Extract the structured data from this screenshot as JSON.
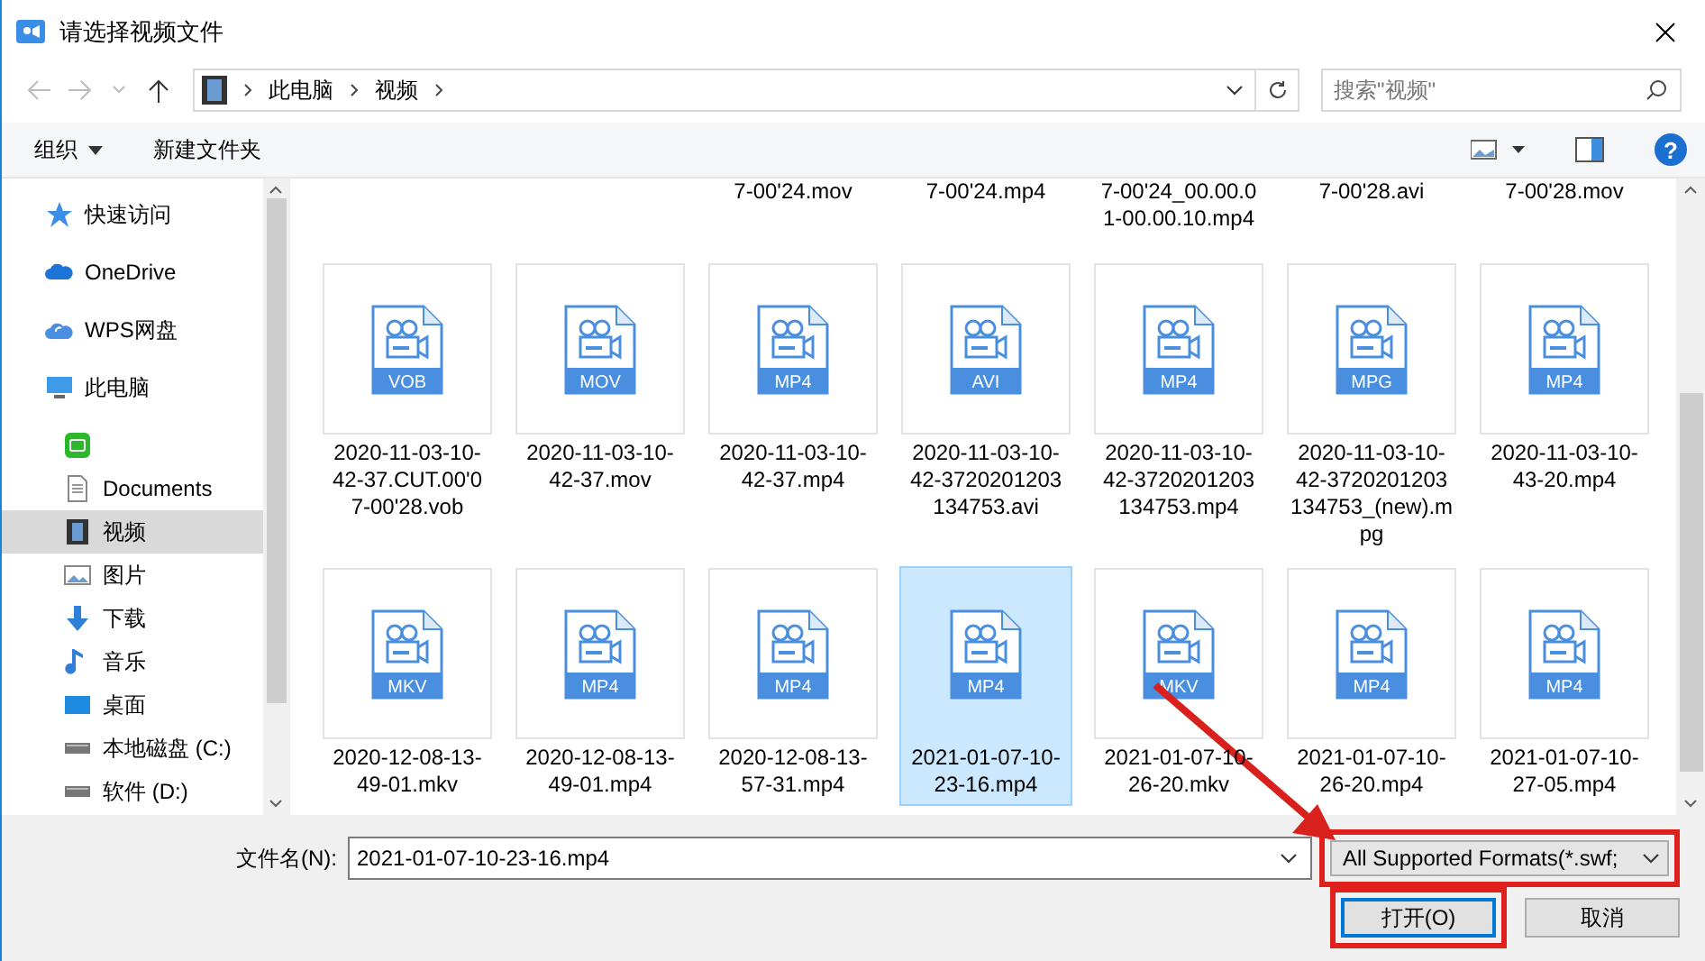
{
  "window": {
    "title": "请选择视频文件"
  },
  "address": {
    "path": [
      "此电脑",
      "视频"
    ]
  },
  "search": {
    "placeholder": "搜索\"视频\""
  },
  "toolbar": {
    "organize": "组织",
    "new_folder": "新建文件夹",
    "help": "?"
  },
  "sidebar": {
    "items": [
      {
        "kind": "star",
        "label": "快速访问",
        "selected": false
      },
      {
        "kind": "cloud",
        "label": "OneDrive",
        "selected": false
      },
      {
        "kind": "wps",
        "label": "WPS网盘",
        "selected": false
      },
      {
        "kind": "computer",
        "label": "此电脑",
        "selected": false,
        "children": [
          {
            "kind": "app",
            "selected": false
          },
          {
            "kind": "document",
            "label": "Documents",
            "selected": false
          },
          {
            "kind": "video",
            "label": "视频",
            "selected": true
          },
          {
            "kind": "picture",
            "label": "图片",
            "selected": false
          },
          {
            "kind": "download",
            "label": "下载",
            "selected": false
          },
          {
            "kind": "music",
            "label": "音乐",
            "selected": false
          },
          {
            "kind": "desktop",
            "label": "桌面",
            "selected": false
          },
          {
            "kind": "drive",
            "label": "本地磁盘 (C:)",
            "selected": false
          },
          {
            "kind": "drive",
            "label": "软件 (D:)",
            "selected": false
          }
        ]
      }
    ]
  },
  "partial_row": [
    {
      "lines": [
        "7-00'24.mov"
      ]
    },
    {
      "lines": [
        "7-00'24.mp4"
      ]
    },
    {
      "lines": [
        "7-00'24_00.00.0",
        "1-00.00.10.mp4"
      ]
    },
    {
      "lines": [
        "7-00'28.avi"
      ]
    },
    {
      "lines": [
        "7-00'28.mov"
      ]
    }
  ],
  "files": [
    {
      "badge": "VOB",
      "lines": [
        "2020-11-03-10-",
        "42-37.CUT.00'0",
        "7-00'28.vob"
      ],
      "selected": false
    },
    {
      "badge": "MOV",
      "lines": [
        "2020-11-03-10-",
        "42-37.mov"
      ],
      "selected": false
    },
    {
      "badge": "MP4",
      "lines": [
        "2020-11-03-10-",
        "42-37.mp4"
      ],
      "selected": false
    },
    {
      "badge": "AVI",
      "lines": [
        "2020-11-03-10-",
        "42-3720201203",
        "134753.avi"
      ],
      "selected": false
    },
    {
      "badge": "MP4",
      "lines": [
        "2020-11-03-10-",
        "42-3720201203",
        "134753.mp4"
      ],
      "selected": false
    },
    {
      "badge": "MPG",
      "lines": [
        "2020-11-03-10-",
        "42-3720201203",
        "134753_(new).m",
        "pg"
      ],
      "selected": false
    },
    {
      "badge": "MP4",
      "lines": [
        "2020-11-03-10-",
        "43-20.mp4"
      ],
      "selected": false
    },
    {
      "badge": "MKV",
      "lines": [
        "2020-12-08-13-",
        "49-01.mkv"
      ],
      "selected": false
    },
    {
      "badge": "MP4",
      "lines": [
        "2020-12-08-13-",
        "49-01.mp4"
      ],
      "selected": false
    },
    {
      "badge": "MP4",
      "lines": [
        "2020-12-08-13-",
        "57-31.mp4"
      ],
      "selected": false
    },
    {
      "badge": "MP4",
      "lines": [
        "2021-01-07-10-",
        "23-16.mp4"
      ],
      "selected": true
    },
    {
      "badge": "MKV",
      "lines": [
        "2021-01-07-10-",
        "26-20.mkv"
      ],
      "selected": false
    },
    {
      "badge": "MP4",
      "lines": [
        "2021-01-07-10-",
        "26-20.mp4"
      ],
      "selected": false
    },
    {
      "badge": "MP4",
      "lines": [
        "2021-01-07-10-",
        "27-05.mp4"
      ],
      "selected": false
    }
  ],
  "footer": {
    "filename_label": "文件名(N):",
    "filename": "2021-01-07-10-23-16.mp4",
    "format": {
      "value": "All Supported Formats(*.swf;",
      "highlighted": true
    },
    "open_button": {
      "label": "打开(O)",
      "highlighted": true
    },
    "cancel_button": {
      "label": "取消"
    }
  },
  "annotation_arrow": true
}
